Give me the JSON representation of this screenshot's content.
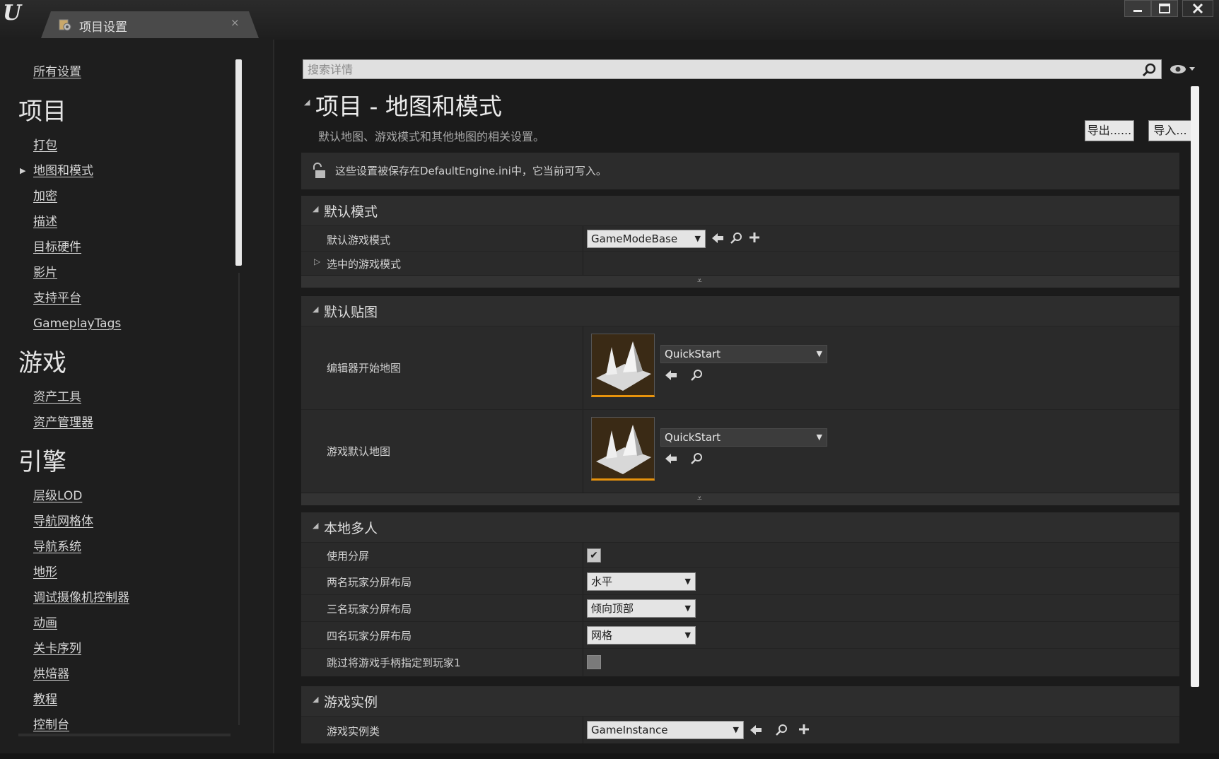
{
  "window": {
    "tab_title": "项目设置",
    "tab_close": "×",
    "logo_glyph": "U",
    "controls": [
      "minimize",
      "maximize",
      "close"
    ]
  },
  "sidebar": {
    "all_settings": "所有设置",
    "sections": [
      {
        "title": "项目",
        "items": [
          "打包",
          "地图和模式",
          "加密",
          "描述",
          "目标硬件",
          "影片",
          "支持平台",
          "GameplayTags"
        ]
      },
      {
        "title": "游戏",
        "items": [
          "资产工具",
          "资产管理器"
        ]
      },
      {
        "title": "引擎",
        "items": [
          "层级LOD",
          "导航网格体",
          "导航系统",
          "地形",
          "调试摄像机控制器",
          "动画",
          "关卡序列",
          "烘焙器",
          "教程",
          "控制台"
        ]
      }
    ],
    "active_item": "地图和模式"
  },
  "search": {
    "placeholder": "搜索详情"
  },
  "header": {
    "title": "项目 - 地图和模式",
    "description": "默认地图、游戏模式和其他地图的相关设置。",
    "export_label": "导出......",
    "import_label": "导入..."
  },
  "notice": {
    "text": "这些设置被保存在DefaultEngine.ini中，它当前可写入。"
  },
  "categories": {
    "default_modes": {
      "title": "默认模式",
      "default_game_mode_label": "默认游戏模式",
      "default_game_mode_value": "GameModeBase",
      "selected_game_mode_label": "选中的游戏模式"
    },
    "default_maps": {
      "title": "默认贴图",
      "editor_startup_map_label": "编辑器开始地图",
      "editor_startup_map_value": "QuickStart",
      "game_default_map_label": "游戏默认地图",
      "game_default_map_value": "QuickStart"
    },
    "local_multiplayer": {
      "title": "本地多人",
      "use_splitscreen_label": "使用分屏",
      "use_splitscreen_checked": true,
      "two_player_label": "两名玩家分屏布局",
      "two_player_value": "水平",
      "three_player_label": "三名玩家分屏布局",
      "three_player_value": "倾向顶部",
      "four_player_label": "四名玩家分屏布局",
      "four_player_value": "网格",
      "skip_gamepad_label": "跳过将游戏手柄指定到玩家1",
      "skip_gamepad_checked": false
    },
    "game_instance": {
      "title": "游戏实例",
      "game_instance_class_label": "游戏实例类",
      "game_instance_class_value": "GameInstance"
    }
  },
  "colors": {
    "accent_orange": "#e8930c",
    "panel": "#2a2a2a",
    "background": "#1b1b1b"
  }
}
